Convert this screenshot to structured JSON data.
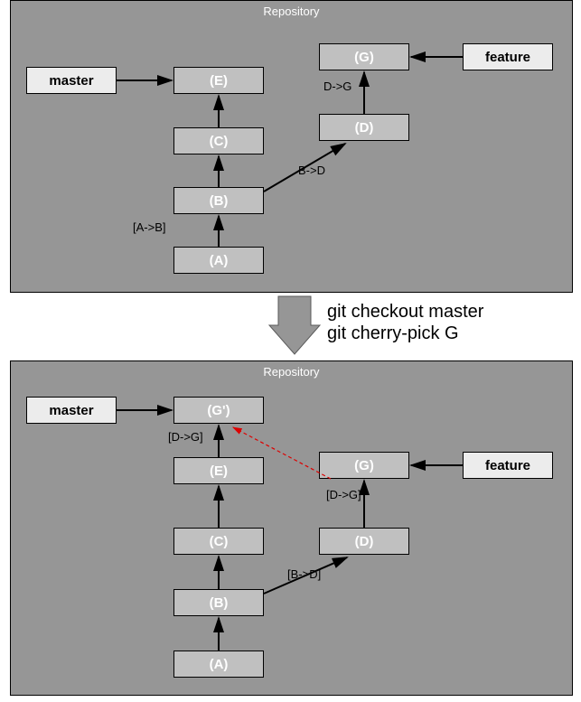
{
  "top": {
    "title": "Repository",
    "branches": {
      "master": "master",
      "feature": "feature"
    },
    "commits": {
      "A": "(A)",
      "B": "(B)",
      "C": "(C)",
      "E": "(E)",
      "D": "(D)",
      "G": "(G)"
    },
    "labels": {
      "ab": "[A->B]",
      "bd": "B->D",
      "dg": "D->G"
    }
  },
  "transition": {
    "cmd1": "git checkout master",
    "cmd2": "git cherry-pick G"
  },
  "bottom": {
    "title": "Repository",
    "branches": {
      "master": "master",
      "feature": "feature"
    },
    "commits": {
      "A": "(A)",
      "B": "(B)",
      "C": "(C)",
      "E": "(E)",
      "Gp": "(G')",
      "D": "(D)",
      "G": "(G)"
    },
    "labels": {
      "dg_left": "[D->G]",
      "bd": "[B->D]",
      "dg_right": "[D->G]"
    }
  }
}
